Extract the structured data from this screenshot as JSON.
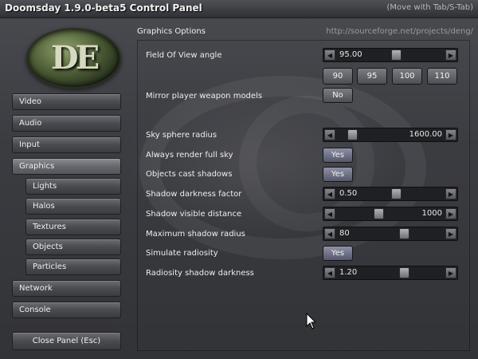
{
  "window": {
    "title": "Doomsday 1.9.0-beta5 Control Panel",
    "hint": "(Move with Tab/S-Tab)"
  },
  "logo": {
    "text": "DE"
  },
  "sidebar": {
    "items": [
      {
        "label": "Video",
        "active": false,
        "sub": false
      },
      {
        "label": "Audio",
        "active": false,
        "sub": false
      },
      {
        "label": "Input",
        "active": false,
        "sub": false
      },
      {
        "label": "Graphics",
        "active": true,
        "sub": false
      },
      {
        "label": "Lights",
        "active": false,
        "sub": true
      },
      {
        "label": "Halos",
        "active": false,
        "sub": true
      },
      {
        "label": "Textures",
        "active": false,
        "sub": true
      },
      {
        "label": "Objects",
        "active": false,
        "sub": true
      },
      {
        "label": "Particles",
        "active": false,
        "sub": true
      },
      {
        "label": "Network",
        "active": false,
        "sub": false
      },
      {
        "label": "Console",
        "active": false,
        "sub": false
      }
    ],
    "close_label": "Close Panel (Esc)"
  },
  "main": {
    "section_title": "Graphics Options",
    "url": "http://sourceforge.net/projects/deng/",
    "settings": {
      "fov": {
        "label": "Field Of View angle",
        "value": "95.00",
        "level": 0.5
      },
      "fov_presets": [
        "90",
        "95",
        "100",
        "110"
      ],
      "mirror_weapons": {
        "label": "Mirror player weapon models",
        "value": "No"
      },
      "sky_radius": {
        "label": "Sky sphere radius",
        "value": "1600.00",
        "level": 0.0
      },
      "full_sky": {
        "label": "Always render full sky",
        "value": "Yes"
      },
      "cast_shadows": {
        "label": "Objects cast shadows",
        "value": "Yes"
      },
      "shadow_darkness": {
        "label": "Shadow darkness factor",
        "value": "0.50",
        "level": 0.5
      },
      "shadow_distance": {
        "label": "Shadow visible distance",
        "value": "1000",
        "level": 0.3
      },
      "shadow_radius": {
        "label": "Maximum shadow radius",
        "value": "80",
        "level": 0.6
      },
      "radiosity": {
        "label": "Simulate radiosity",
        "value": "Yes"
      },
      "radiosity_darkness": {
        "label": "Radiosity shadow darkness",
        "value": "1.20",
        "level": 0.6
      }
    }
  },
  "colors": {
    "background": "#3a3b3f",
    "button": "#55575b",
    "toggle_on": "#6f7186",
    "text": "#eeeeee"
  }
}
